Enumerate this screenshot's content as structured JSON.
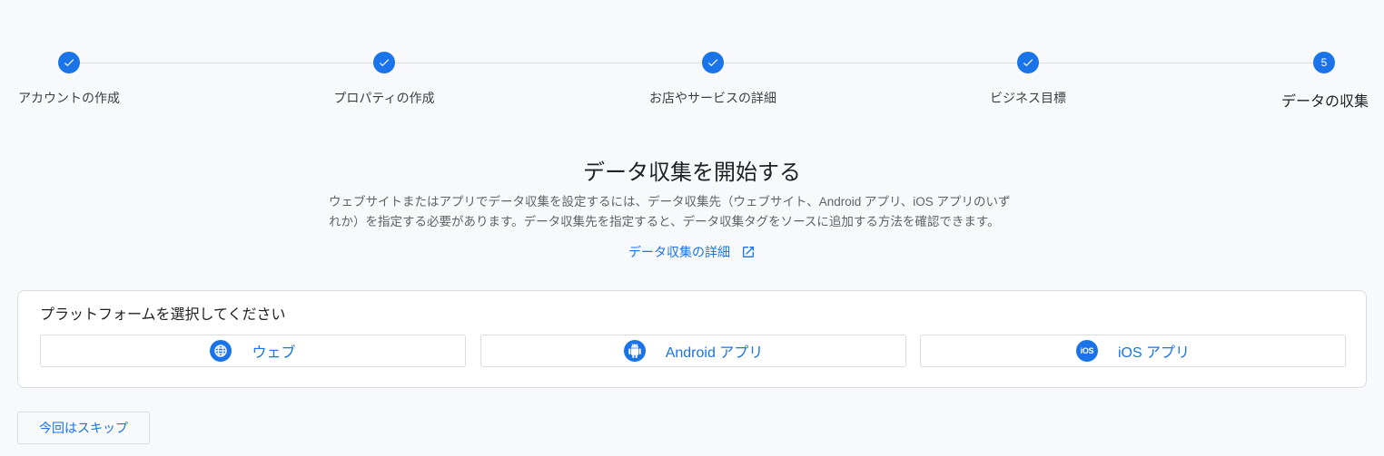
{
  "stepper": {
    "steps": [
      {
        "label": "アカウントの作成",
        "status": "done",
        "icon": "check-icon"
      },
      {
        "label": "プロパティの作成",
        "status": "done",
        "icon": "check-icon"
      },
      {
        "label": "お店やサービスの詳細",
        "status": "done",
        "icon": "check-icon"
      },
      {
        "label": "ビジネス目標",
        "status": "done",
        "icon": "check-icon"
      },
      {
        "label": "データの収集",
        "status": "current",
        "number": "5"
      }
    ]
  },
  "intro": {
    "title": "データ収集を開始する",
    "description_line1": "ウェブサイトまたはアプリでデータ収集を設定するには、データ収集先（ウェブサイト、Android アプリ、iOS アプリのいず",
    "description_line2": "れか）を指定する必要があります。データ収集先を指定すると、データ収集タグをソースに追加する方法を確認できます。",
    "learn_more": "データ収集の詳細",
    "learn_more_icon": "open-in-new-icon"
  },
  "platform": {
    "heading": "プラットフォームを選択してください",
    "options": [
      {
        "label": "ウェブ",
        "icon": "globe-icon"
      },
      {
        "label": "Android アプリ",
        "icon": "android-icon"
      },
      {
        "label": "iOS アプリ",
        "icon": "ios-icon",
        "icon_text": "iOS"
      }
    ]
  },
  "skip_label": "今回はスキップ",
  "colors": {
    "accent": "#1a73e8",
    "background": "#f8f9fa",
    "border": "#dadce0"
  }
}
